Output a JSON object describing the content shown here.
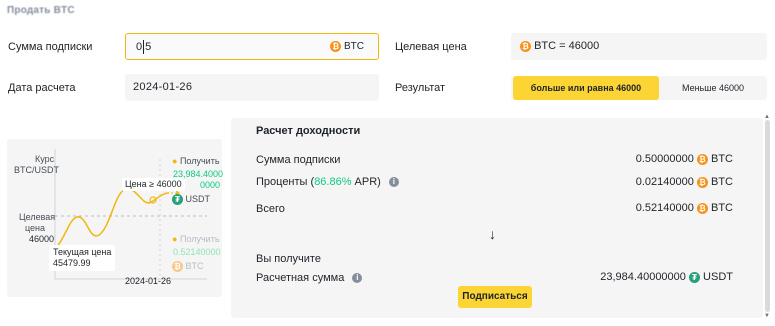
{
  "page": {
    "title": "Продать BTC"
  },
  "form": {
    "amount_label": "Сумма подписки",
    "amount_value": "0.5",
    "amount_currency": "BTC",
    "target_label": "Целевая цена",
    "target_value": "BTC = 46000",
    "date_label": "Дата расчета",
    "date_value": "2024-01-26",
    "result_label": "Результат",
    "result_options": [
      "больше или равна 46000",
      "Меньше 46000"
    ],
    "result_selected": "больше или равна 46000"
  },
  "chart": {
    "rate_label_1": "Курс",
    "rate_label_2": "BTC/USDT",
    "target_label_1": "Целевая",
    "target_label_2": "цена",
    "target_label_3": "46000",
    "current_label_1": "Текущая цена",
    "current_label_2": "45479.99",
    "price_badge": "Цена ≥ 46000",
    "get_label_top": "Получить",
    "get_amount_top_1": "23,984.4000",
    "get_amount_top_2": "0000",
    "get_currency_top": "USDT",
    "get_label_bottom": "Получить",
    "get_amount_bottom": "0.52140000",
    "get_currency_bottom": "BTC",
    "date": "2024-01-26",
    "colors": {
      "curve": "#f0b90b",
      "green": "#0ecb81",
      "grey": "#b7bdc6"
    }
  },
  "result": {
    "title": "Расчет доходности",
    "rows": [
      {
        "label": "Сумма подписки",
        "value": "0.50000000",
        "currency": "BTC"
      },
      {
        "label_prefix": "Проценты (",
        "apr": "86.86%",
        "label_suffix": " APR)",
        "value": "0.02140000",
        "currency": "BTC"
      },
      {
        "label": "Всего",
        "value": "0.52140000",
        "currency": "BTC"
      }
    ],
    "arrow": "↓",
    "you_get_label": "Вы получите",
    "estimated_label": "Расчетная сумма",
    "estimated_value": "23,984.40000000",
    "estimated_currency": "USDT",
    "subscribe_label": "Подписаться"
  },
  "icons": {
    "btc": "btc-coin-icon",
    "usdt": "usdt-coin-icon",
    "info": "info-icon",
    "down_arrow": "down-arrow-icon"
  }
}
